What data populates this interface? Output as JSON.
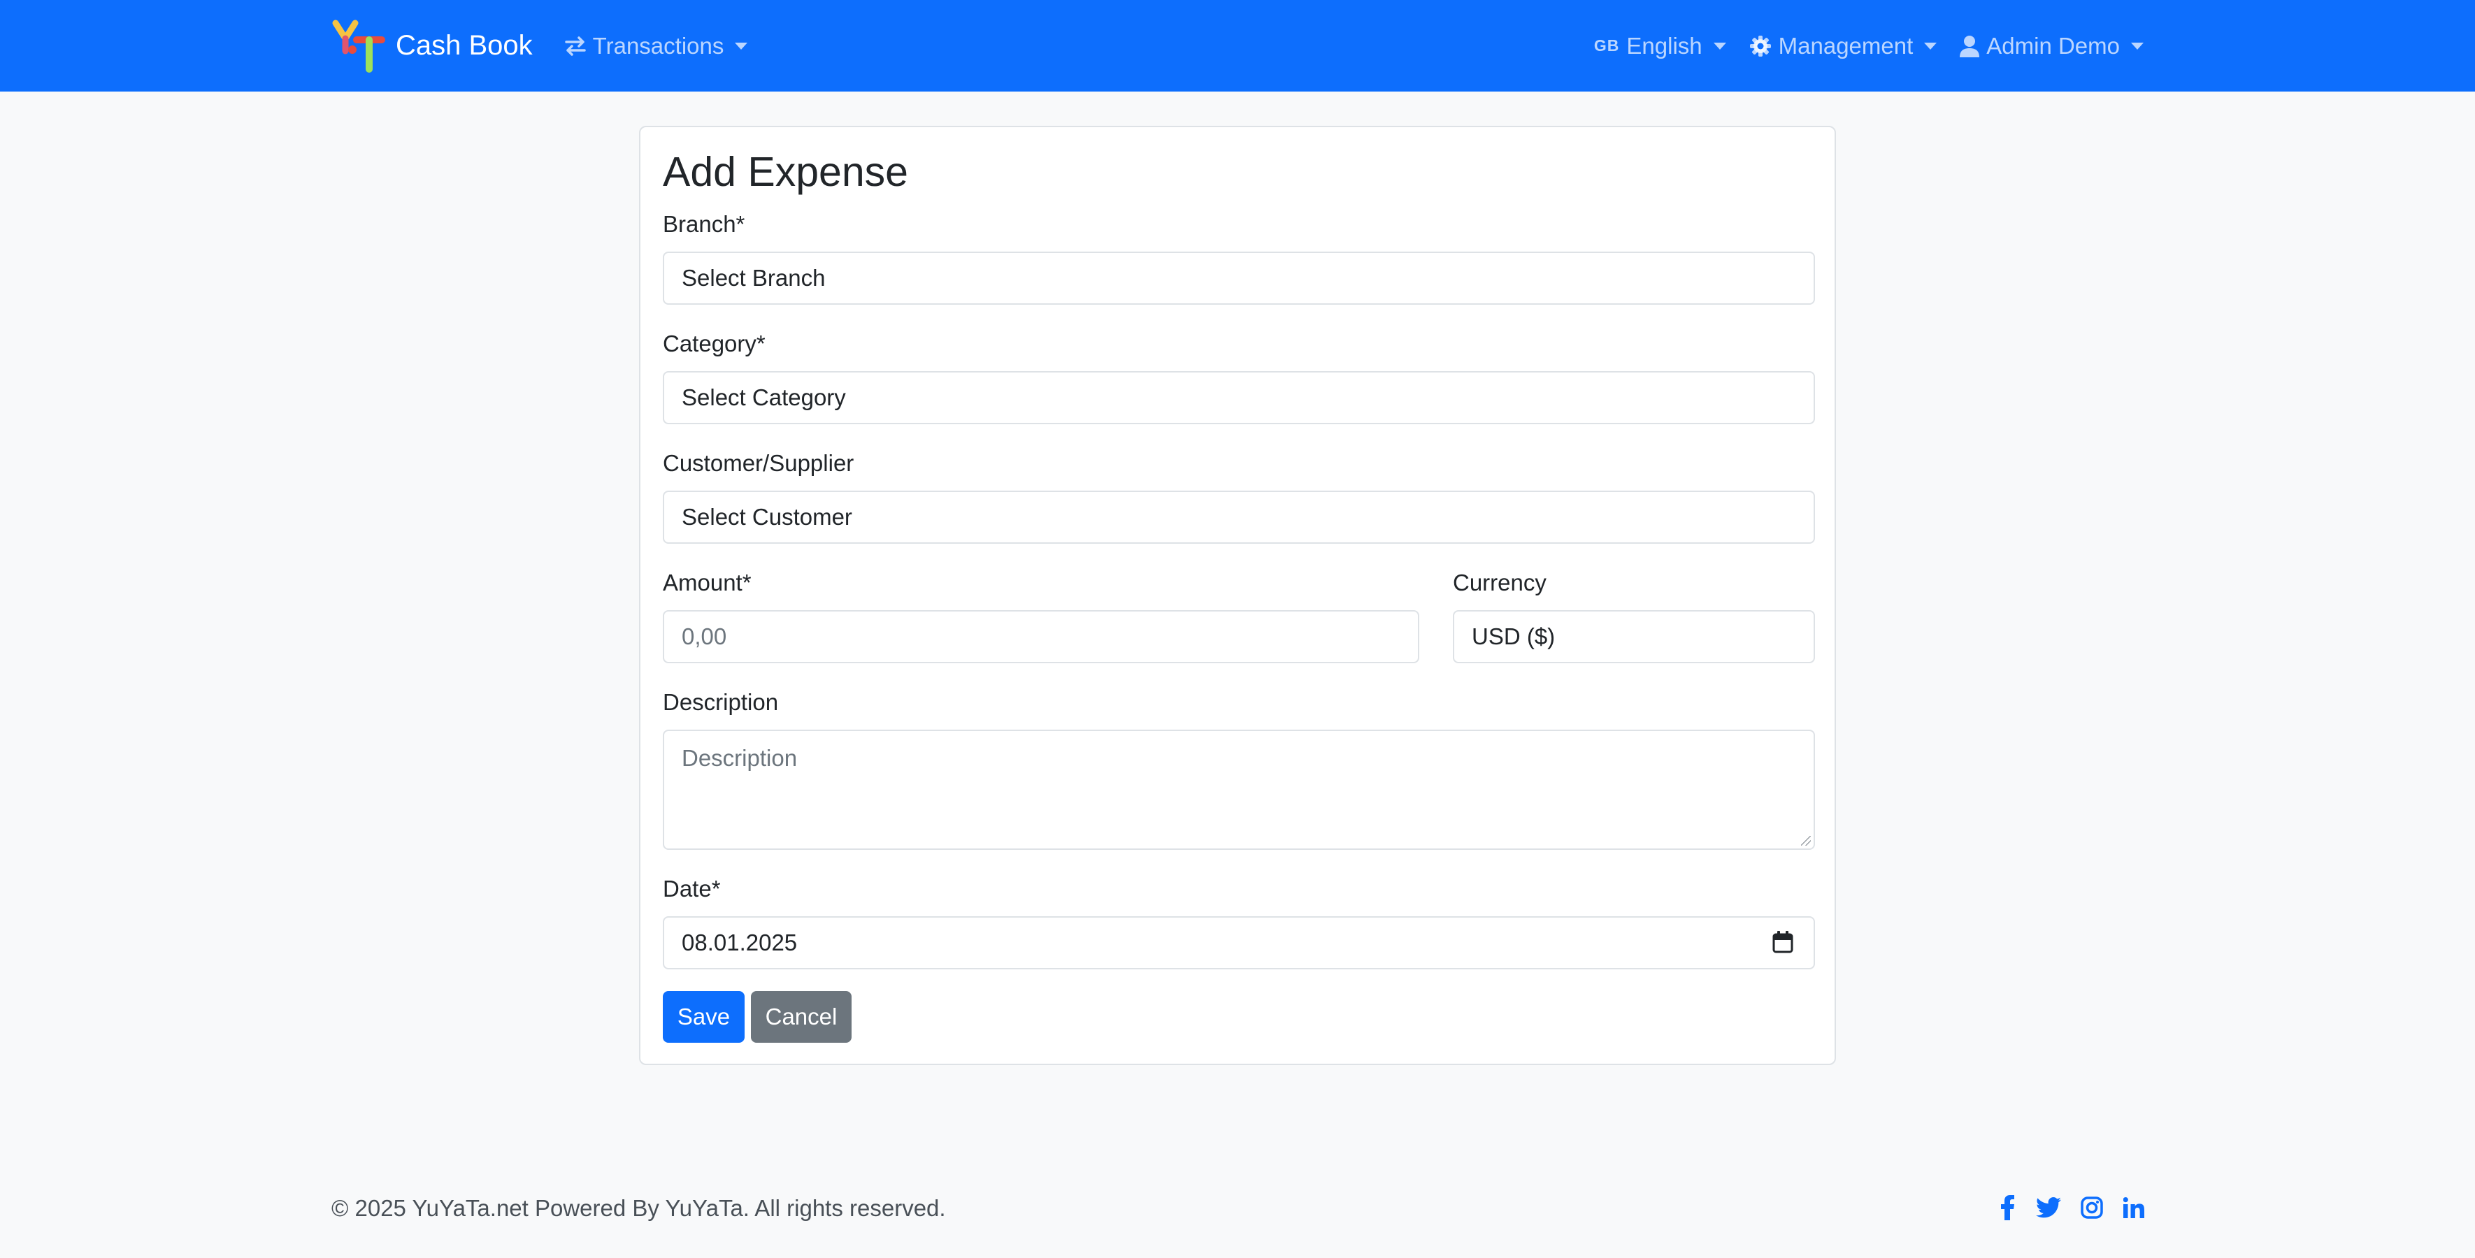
{
  "navbar": {
    "brand": "Cash Book",
    "transactions_label": "Transactions",
    "language_flag": "GB",
    "language_label": "English",
    "management_label": "Management",
    "user_label": "Admin Demo",
    "color": "#0d6efd"
  },
  "form": {
    "title": "Add Expense",
    "branch": {
      "label": "Branch*",
      "value": "Select Branch"
    },
    "category": {
      "label": "Category*",
      "value": "Select Category"
    },
    "customer": {
      "label": "Customer/Supplier",
      "value": "Select Customer"
    },
    "amount": {
      "label": "Amount*",
      "placeholder": "0,00"
    },
    "currency": {
      "label": "Currency",
      "value": "USD ($)"
    },
    "description": {
      "label": "Description",
      "placeholder": "Description"
    },
    "date": {
      "label": "Date*",
      "value": "08.01.2025"
    },
    "save_label": "Save",
    "cancel_label": "Cancel"
  },
  "footer": {
    "copyright": "© 2025 YuYaTa.net Powered By YuYaTa. All rights reserved.",
    "social_icons": [
      "facebook-icon",
      "twitter-icon",
      "instagram-icon",
      "linkedin-icon"
    ]
  }
}
